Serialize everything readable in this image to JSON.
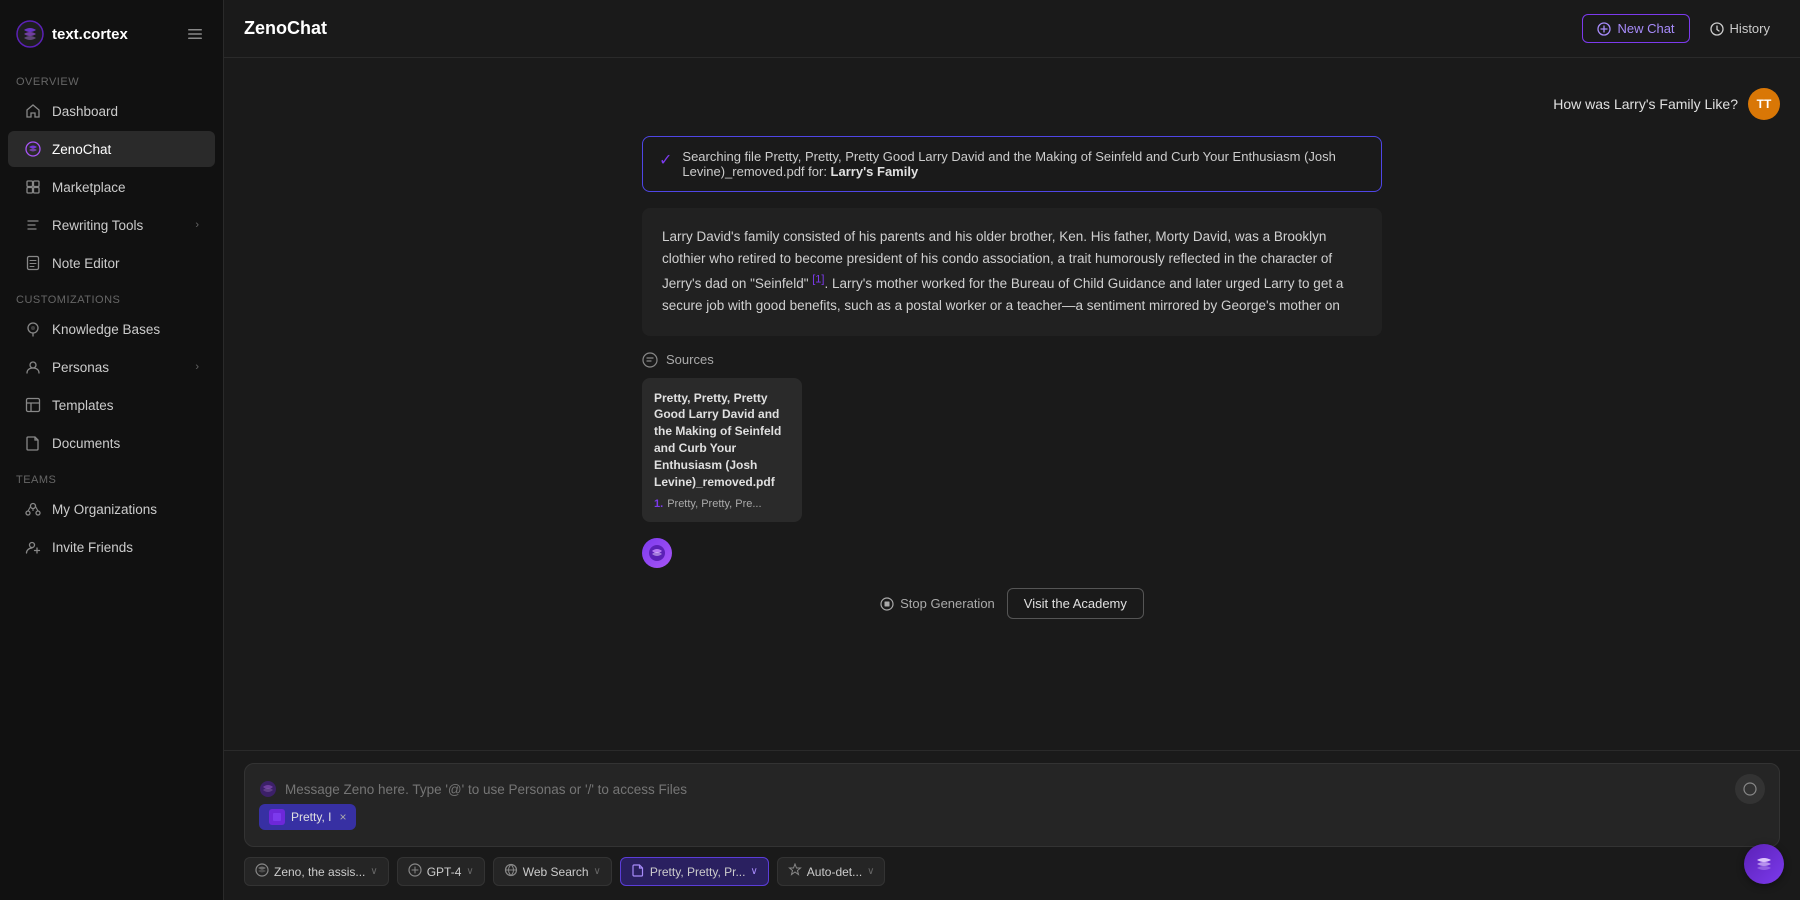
{
  "app": {
    "logo_text": "text.cortex",
    "title": "ZenoChat"
  },
  "header": {
    "title": "ZenoChat",
    "new_chat_label": "New Chat",
    "history_label": "History"
  },
  "sidebar": {
    "overview_label": "Overview",
    "customizations_label": "Customizations",
    "teams_label": "Teams",
    "items": [
      {
        "id": "dashboard",
        "label": "Dashboard",
        "icon": "home"
      },
      {
        "id": "zenochat",
        "label": "ZenoChat",
        "icon": "zeno",
        "active": true
      },
      {
        "id": "marketplace",
        "label": "Marketplace",
        "icon": "marketplace"
      },
      {
        "id": "rewriting-tools",
        "label": "Rewriting Tools",
        "icon": "rewrite",
        "has_chevron": true
      },
      {
        "id": "note-editor",
        "label": "Note Editor",
        "icon": "note"
      },
      {
        "id": "knowledge-bases",
        "label": "Knowledge Bases",
        "icon": "knowledge"
      },
      {
        "id": "personas",
        "label": "Personas",
        "icon": "persona",
        "has_chevron": true
      },
      {
        "id": "templates",
        "label": "Templates",
        "icon": "template"
      },
      {
        "id": "documents",
        "label": "Documents",
        "icon": "document"
      },
      {
        "id": "my-organizations",
        "label": "My Organizations",
        "icon": "org"
      },
      {
        "id": "invite-friends",
        "label": "Invite Friends",
        "icon": "invite"
      }
    ]
  },
  "chat": {
    "user_initials": "TT",
    "user_question": "How was Larry's Family Like?",
    "search_status": {
      "text": "Searching file Pretty, Pretty, Pretty Good Larry David and the Making of Seinfeld and Curb Your Enthusiasm (Josh Levine)_removed.pdf for:",
      "bold": "Larry's Family"
    },
    "ai_response": "Larry David's family consisted of his parents and his older brother, Ken. His father, Morty David, was a Brooklyn clothier who retired to become president of his condo association, a trait humorously reflected in the character of Jerry's dad on \"Seinfeld\" [1]. Larry's mother worked for the Bureau of Child Guidance and later urged Larry to get a secure job with good benefits, such as a postal worker or a teacher—a sentiment mirrored by George's mother on",
    "citation": "[1]",
    "sources_label": "Sources",
    "source_card": {
      "title": "Pretty, Pretty, Pretty Good Larry David and the Making of Seinfeld and Curb Your Enthusiasm (Josh Levine)_removed.pdf",
      "item": "Pretty, Pretty, Pre..."
    }
  },
  "actions": {
    "stop_generation": "Stop Generation",
    "visit_academy": "Visit the Academy"
  },
  "input": {
    "placeholder": "Message Zeno here. Type '@' to use Personas or '/' to access Files",
    "attached_file": "Pretty, I",
    "send_icon": "○"
  },
  "toolbar": {
    "persona_label": "Zeno, the assis...",
    "model_label": "GPT-4",
    "web_search_label": "Web Search",
    "file_label": "Pretty, Pretty, Pr...",
    "auto_detect_label": "Auto-det..."
  }
}
